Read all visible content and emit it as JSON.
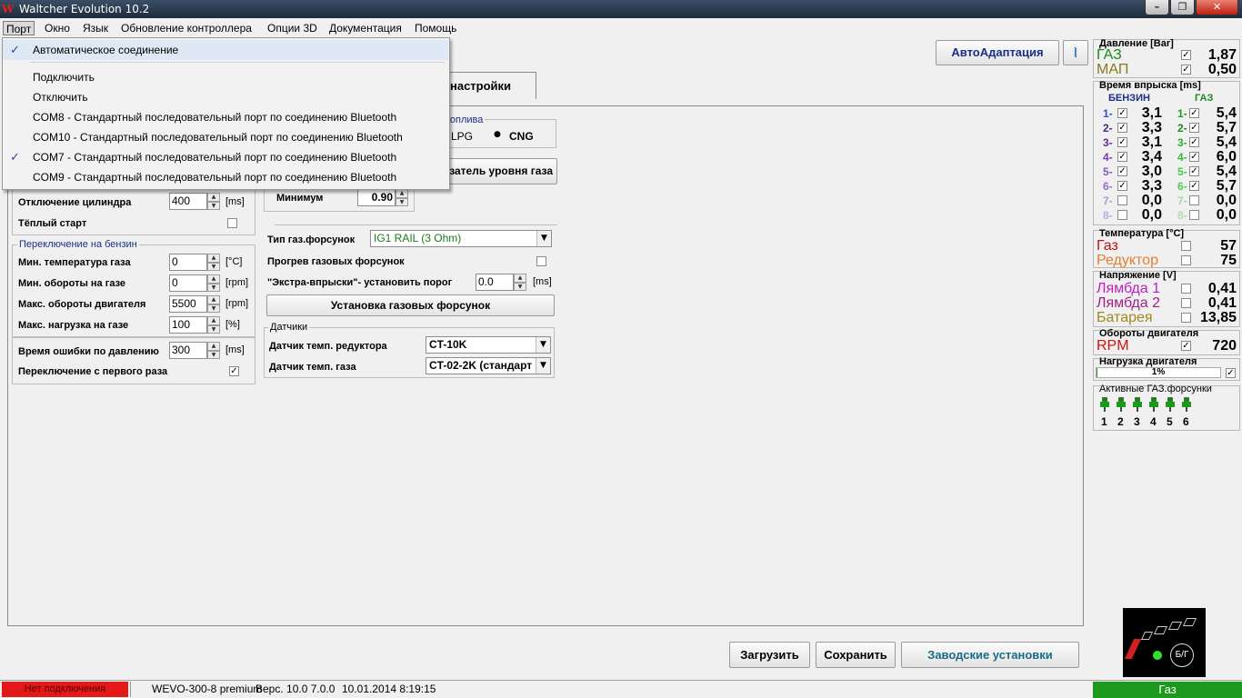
{
  "window": {
    "title": "Waltcher Evolution  10.2",
    "logo": "W",
    "min": "–",
    "max": "❐",
    "close": "✕"
  },
  "menu": {
    "items": [
      "Порт",
      "Окно",
      "Язык",
      "Обновление контроллера",
      "Опции 3D",
      "Документация",
      "Помощь"
    ]
  },
  "port_menu": {
    "items": [
      {
        "label": "Автоматическое соединение",
        "checked": true
      },
      {
        "label": "Подключить",
        "checked": false
      },
      {
        "label": "Отключить",
        "checked": false
      },
      {
        "label": "COM8 - Стандартный последовательный порт по соединению Bluetooth",
        "checked": false
      },
      {
        "label": "COM10 - Стандартный последовательный порт по соединению Bluetooth",
        "checked": false
      },
      {
        "label": "COM7 - Стандартный последовательный порт по соединению Bluetooth",
        "checked": true
      },
      {
        "label": "COM9 - Стандартный последовательный порт по соединению Bluetooth",
        "checked": false
      }
    ],
    "check_glyph": "✓"
  },
  "toolbar": {
    "autoadapt": "АвтоАдаптация",
    "icon_glyph": "⦚"
  },
  "tabs": {
    "active": "настройки"
  },
  "fuel": {
    "title": "топлива",
    "lpg": "LPG",
    "cng": "CNG",
    "radio_dot": "●",
    "selected": "CNG"
  },
  "level_sensor_button": "затель уровня газа",
  "minimum": {
    "label": "Минимум",
    "value": "0.90"
  },
  "cylinder_cutoff": {
    "label": "Отключение цилиндра",
    "value": "400",
    "unit": "[ms]"
  },
  "warm_start": {
    "label": "Тёплый старт",
    "checked": false
  },
  "switch_to_petrol": {
    "title": "Переключение на бензин",
    "rows": [
      {
        "label": "Мин. температура газа",
        "value": "0",
        "unit": "[°C]"
      },
      {
        "label": "Мин. обороты на газе",
        "value": "0",
        "unit": "[rpm]"
      },
      {
        "label": "Макс. обороты двигателя",
        "value": "5500",
        "unit": "[rpm]"
      },
      {
        "label": "Макс. нагрузка на газе",
        "value": "100",
        "unit": "[%]"
      }
    ]
  },
  "pressure_error": {
    "label": "Время ошибки по давлению",
    "value": "300",
    "unit": "[ms]"
  },
  "switch_first": {
    "label": "Переключение с первого раза",
    "checked": true
  },
  "injector_type": {
    "label": "Тип газ.форсунок",
    "value": "IG1 RAIL (3 Ohm)",
    "value_color": "#1a7a1a"
  },
  "injector_warmup": {
    "label": "Прогрев газовых форсунок",
    "checked": false
  },
  "extra_injections": {
    "label": "\"Экстра-впрыски\"- установить порог",
    "value": "0.0",
    "unit": "[ms]"
  },
  "install_injectors_button": "Установка газовых форсунок",
  "sensors": {
    "title": "Датчики",
    "reducer": {
      "label": "Датчик темп. редуктора",
      "value": "CT-10K"
    },
    "gas": {
      "label": "Датчик темп. газа",
      "value": "CT-02-2K (стандарт"
    }
  },
  "bottom_buttons": {
    "load": "Загрузить",
    "save": "Сохранить",
    "factory": "Заводские установки"
  },
  "monitor": {
    "pressure": {
      "title": "Давление [Bar]",
      "gas_label": "ГАЗ",
      "gas_value": "1,87",
      "map_label": "МАП",
      "map_value": "0,50",
      "gas_color": "#1a8a1a",
      "map_color": "#8a7a1a"
    },
    "injection": {
      "title": "Время впрыска [ms]",
      "petrol_header": "БЕНЗИН",
      "gas_header": "ГАЗ",
      "rows": [
        {
          "n": "1-",
          "petrol": "3,1",
          "gas": "5,4",
          "active": true,
          "pn_color": "#3050d0",
          "gn_color": "#1a9a1a"
        },
        {
          "n": "2-",
          "petrol": "3,3",
          "gas": "5,7",
          "active": true,
          "pn_color": "#4a2a90",
          "gn_color": "#1a8a1a"
        },
        {
          "n": "3-",
          "petrol": "3,1",
          "gas": "5,4",
          "active": true,
          "pn_color": "#6a2aa0",
          "gn_color": "#2ab02a"
        },
        {
          "n": "4-",
          "petrol": "3,4",
          "gas": "6,0",
          "active": true,
          "pn_color": "#7a3ab0",
          "gn_color": "#30c030"
        },
        {
          "n": "5-",
          "petrol": "3,0",
          "gas": "5,4",
          "active": true,
          "pn_color": "#8a5ac0",
          "gn_color": "#40d040"
        },
        {
          "n": "6-",
          "petrol": "3,3",
          "gas": "5,7",
          "active": true,
          "pn_color": "#9a6ad0",
          "gn_color": "#50d050"
        },
        {
          "n": "7-",
          "petrol": "0,0",
          "gas": "0,0",
          "active": false,
          "pn_color": "#a0a0d8",
          "gn_color": "#a0d8a0"
        },
        {
          "n": "8-",
          "petrol": "0,0",
          "gas": "0,0",
          "active": false,
          "pn_color": "#b0b0e0",
          "gn_color": "#b0e0b0"
        }
      ]
    },
    "temperature": {
      "title": "Температура  [°C]",
      "gas_label": "Газ",
      "gas_value": "57",
      "reducer_label": "Редуктор",
      "reducer_value": "75",
      "gas_color": "#c01010",
      "reducer_color": "#e08030"
    },
    "voltage": {
      "title": "Напряжение [V]",
      "lambda1_label": "Лямбда 1",
      "lambda1_value": "0,41",
      "lambda2_label": "Лямбда 2",
      "lambda2_value": "0,41",
      "battery_label": "Батарея",
      "battery_value": "13,85",
      "lambda1_color": "#c020c0",
      "lambda2_color": "#a0208a",
      "battery_color": "#a08a20"
    },
    "rpm": {
      "title": "Обороты двигателя",
      "label": "RPM",
      "value": "720",
      "color": "#d01010"
    },
    "load": {
      "title": "Нагрузка двигателя",
      "value": "1%",
      "fraction": 0.01
    },
    "active_injectors": {
      "title": "Активные ГАЗ.форсунки",
      "numbers": [
        "1",
        "2",
        "3",
        "4",
        "5",
        "6"
      ]
    }
  },
  "switch_widget": {
    "label": "Б/Г"
  },
  "status": {
    "connection": "Нет подключения",
    "device": "WEVO-300-8 premium",
    "version": "Верс. 10.0  7.0.0",
    "datetime": "10.01.2014 8:19:15",
    "fuel_mode": "Газ"
  }
}
